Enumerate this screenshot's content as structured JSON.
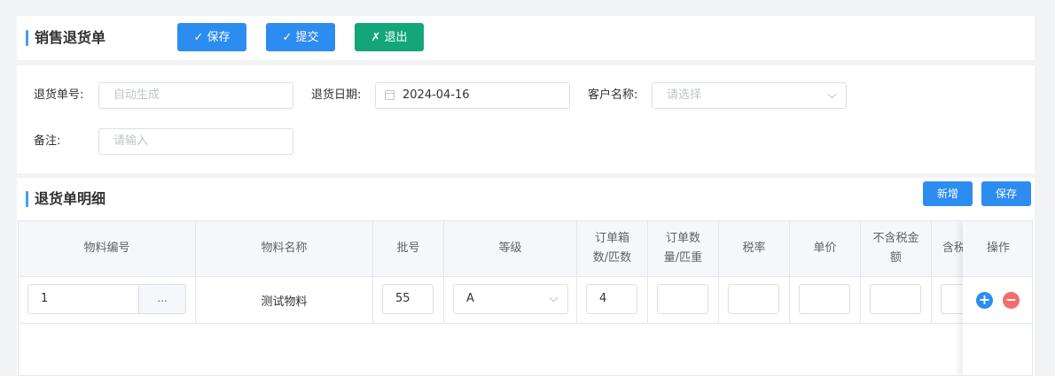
{
  "header": {
    "title": "销售退货单",
    "save_label": "保存",
    "submit_label": "提交",
    "exit_label": "退出",
    "check_glyph": "✓",
    "x_glyph": "✗"
  },
  "form": {
    "return_no_label": "退货单号:",
    "return_no_placeholder": "自动生成",
    "return_date_label": "退货日期:",
    "return_date_value": "2024-04-16",
    "customer_label": "客户名称:",
    "customer_placeholder": "请选择",
    "remark_label": "备注:",
    "remark_placeholder": "请输入"
  },
  "detail": {
    "title": "退货单明细",
    "add_label": "新增",
    "save_label": "保存"
  },
  "table": {
    "headers": {
      "material_no": "物料编号",
      "material_name": "物料名称",
      "batch": "批号",
      "grade": "等级",
      "order_boxes_line1": "订单箱",
      "order_boxes_line2": "数/匹数",
      "order_qty_line1": "订单数",
      "order_qty_line2": "量/匹重",
      "tax_rate": "税率",
      "unit_price": "单价",
      "excl_tax_line1": "不含税金",
      "excl_tax_line2": "额",
      "incl_tax": "含税",
      "actions": "操作"
    },
    "rows": [
      {
        "material_no": "1",
        "ellipsis": "...",
        "material_name": "测试物料",
        "batch": "55",
        "grade": "A",
        "order_boxes": "4"
      }
    ]
  },
  "colors": {
    "primary": "#2d8cf0",
    "success": "#13a67a",
    "accent_bar": "#409eff",
    "add_round": "#2d8cf0",
    "remove_round": "#f56c6c"
  },
  "icons": {
    "calendar": "calendar-icon",
    "dropdown": "chevron-down-icon",
    "add": "plus-circle-icon",
    "remove": "minus-circle-icon"
  }
}
